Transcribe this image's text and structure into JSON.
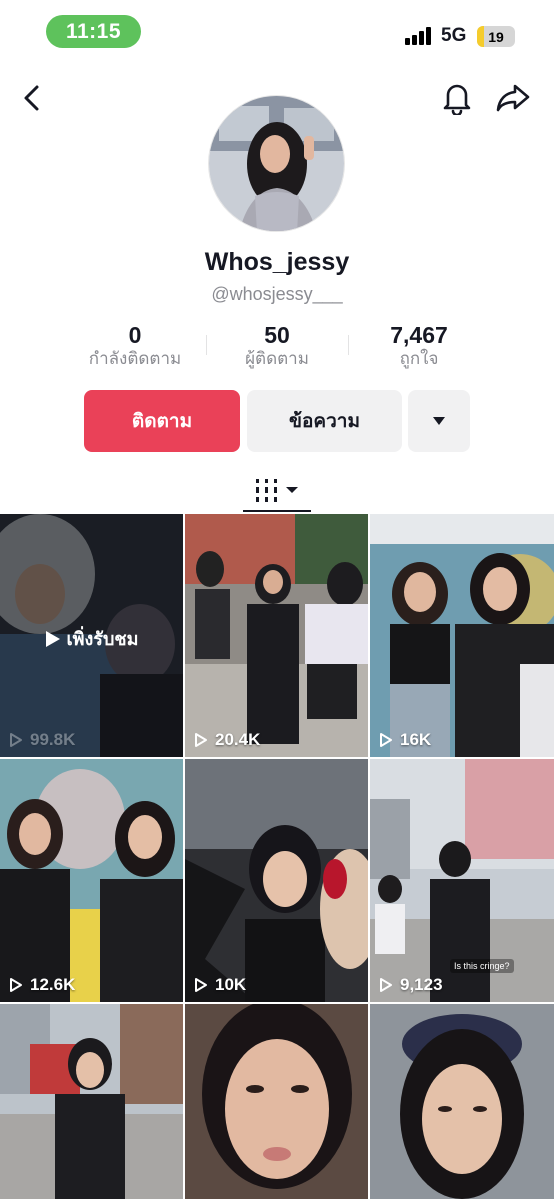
{
  "status_bar": {
    "time": "11:15",
    "network": "5G",
    "battery": "19",
    "battery_level": 0.19,
    "colors": {
      "time_pill": "#5ec25c",
      "battery_fill": "#f5cc2c"
    }
  },
  "nav": {
    "back_icon": "chevron-left-icon",
    "notify_icon": "bell-icon",
    "share_icon": "share-arrow-icon"
  },
  "profile": {
    "display_name": "Whos_jessy",
    "handle": "@whosjessy___",
    "stats": [
      {
        "value": "0",
        "label": "กำลังติดตาม"
      },
      {
        "value": "50",
        "label": "ผู้ติดตาม"
      },
      {
        "value": "7,467",
        "label": "ถูกใจ"
      }
    ]
  },
  "actions": {
    "follow_label": "ติดตาม",
    "message_label": "ข้อความ",
    "more_icon": "caret-down-icon",
    "accent": "#ea4158"
  },
  "tabs": {
    "active_icon": "videos-grid-icon"
  },
  "videos": [
    {
      "views": "99.8K",
      "overlay_label": "เพิ่งรับชม"
    },
    {
      "views": "20.4K"
    },
    {
      "views": "16K"
    },
    {
      "views": "12.6K"
    },
    {
      "views": "10K"
    },
    {
      "views": "9,123",
      "caption": "Is this cringe?"
    },
    {
      "views": ""
    },
    {
      "views": ""
    },
    {
      "views": ""
    }
  ]
}
